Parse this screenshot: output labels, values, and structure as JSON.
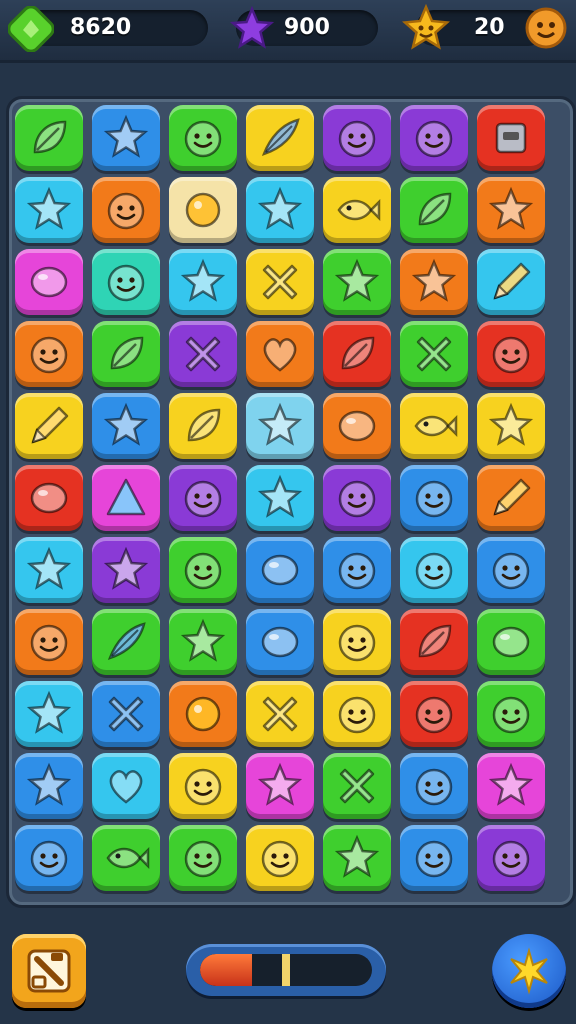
{
  "hud": {
    "score": "8620",
    "stars": "900",
    "level": "20"
  },
  "colors": {
    "green": "#3fcf2e",
    "blue": "#2f8fe8",
    "cyan": "#35c6ee",
    "yellow": "#f7d21f",
    "orange": "#f27a1a",
    "red": "#e53222",
    "purple": "#8a3ad6",
    "magenta": "#e645d9",
    "cream": "#f5e3a8",
    "teal": "#2fd4b5",
    "lightblue": "#7fd3ee"
  },
  "board": {
    "rows": [
      [
        {
          "bg": "green",
          "icon": "leaf-icon"
        },
        {
          "bg": "blue",
          "icon": "star-icon"
        },
        {
          "bg": "green",
          "icon": "smiley-face-icon"
        },
        {
          "bg": "yellow",
          "icon": "feather-icon"
        },
        {
          "bg": "purple",
          "icon": "smiley-face-icon"
        },
        {
          "bg": "purple",
          "icon": "smiley-face-icon"
        },
        {
          "bg": "red",
          "icon": "square-face-icon"
        }
      ],
      [
        {
          "bg": "cyan",
          "icon": "star-icon"
        },
        {
          "bg": "orange",
          "icon": "smiley-face-icon"
        },
        {
          "bg": "cream",
          "icon": "orb-icon"
        },
        {
          "bg": "cyan",
          "icon": "star-icon"
        },
        {
          "bg": "yellow",
          "icon": "fish-icon"
        },
        {
          "bg": "green",
          "icon": "leaf-icon"
        },
        {
          "bg": "orange",
          "icon": "star-icon"
        }
      ],
      [
        {
          "bg": "magenta",
          "icon": "bubble-icon"
        },
        {
          "bg": "teal",
          "icon": "smiley-face-icon"
        },
        {
          "bg": "cyan",
          "icon": "star-icon"
        },
        {
          "bg": "yellow",
          "icon": "cross-icon"
        },
        {
          "bg": "green",
          "icon": "star-icon"
        },
        {
          "bg": "orange",
          "icon": "star-icon"
        },
        {
          "bg": "cyan",
          "icon": "pencil-icon"
        }
      ],
      [
        {
          "bg": "orange",
          "icon": "smiley-face-icon"
        },
        {
          "bg": "green",
          "icon": "leaf-icon"
        },
        {
          "bg": "purple",
          "icon": "cross-icon"
        },
        {
          "bg": "orange",
          "icon": "heart-icon"
        },
        {
          "bg": "red",
          "icon": "leaf-icon"
        },
        {
          "bg": "green",
          "icon": "cross-icon"
        },
        {
          "bg": "red",
          "icon": "smiley-face-icon"
        }
      ],
      [
        {
          "bg": "yellow",
          "icon": "pencil-icon"
        },
        {
          "bg": "blue",
          "icon": "star-icon"
        },
        {
          "bg": "yellow",
          "icon": "leaf-icon"
        },
        {
          "bg": "lightblue",
          "icon": "star-icon"
        },
        {
          "bg": "orange",
          "icon": "bubble-icon"
        },
        {
          "bg": "yellow",
          "icon": "fish-icon"
        },
        {
          "bg": "yellow",
          "icon": "star-icon"
        }
      ],
      [
        {
          "bg": "red",
          "icon": "bubble-icon"
        },
        {
          "bg": "magenta",
          "icon": "triangle-icon"
        },
        {
          "bg": "purple",
          "icon": "smiley-face-icon"
        },
        {
          "bg": "cyan",
          "icon": "star-icon"
        },
        {
          "bg": "purple",
          "icon": "smiley-face-icon"
        },
        {
          "bg": "blue",
          "icon": "smiley-face-icon"
        },
        {
          "bg": "orange",
          "icon": "pencil-icon"
        }
      ],
      [
        {
          "bg": "cyan",
          "icon": "star-icon"
        },
        {
          "bg": "purple",
          "icon": "star-icon"
        },
        {
          "bg": "green",
          "icon": "smiley-face-icon"
        },
        {
          "bg": "blue",
          "icon": "bubble-icon"
        },
        {
          "bg": "blue",
          "icon": "smiley-face-icon"
        },
        {
          "bg": "cyan",
          "icon": "smiley-face-icon"
        },
        {
          "bg": "blue",
          "icon": "smiley-face-icon"
        }
      ],
      [
        {
          "bg": "orange",
          "icon": "smiley-face-icon"
        },
        {
          "bg": "green",
          "icon": "feather-icon"
        },
        {
          "bg": "green",
          "icon": "star-icon"
        },
        {
          "bg": "blue",
          "icon": "bubble-icon"
        },
        {
          "bg": "yellow",
          "icon": "smiley-face-icon"
        },
        {
          "bg": "red",
          "icon": "leaf-icon"
        },
        {
          "bg": "green",
          "icon": "bubble-icon"
        }
      ],
      [
        {
          "bg": "cyan",
          "icon": "star-icon"
        },
        {
          "bg": "blue",
          "icon": "cross-icon"
        },
        {
          "bg": "orange",
          "icon": "orb-icon"
        },
        {
          "bg": "yellow",
          "icon": "cross-icon"
        },
        {
          "bg": "yellow",
          "icon": "smiley-face-icon"
        },
        {
          "bg": "red",
          "icon": "smiley-face-icon"
        },
        {
          "bg": "green",
          "icon": "smiley-face-icon"
        }
      ],
      [
        {
          "bg": "blue",
          "icon": "star-icon"
        },
        {
          "bg": "cyan",
          "icon": "heart-icon"
        },
        {
          "bg": "yellow",
          "icon": "smiley-face-icon"
        },
        {
          "bg": "magenta",
          "icon": "star-icon"
        },
        {
          "bg": "green",
          "icon": "cross-icon"
        },
        {
          "bg": "blue",
          "icon": "smiley-face-icon"
        },
        {
          "bg": "magenta",
          "icon": "star-icon"
        }
      ],
      [
        {
          "bg": "blue",
          "icon": "smiley-face-icon"
        },
        {
          "bg": "green",
          "icon": "fish-icon"
        },
        {
          "bg": "green",
          "icon": "smiley-face-icon"
        },
        {
          "bg": "yellow",
          "icon": "smiley-face-icon"
        },
        {
          "bg": "green",
          "icon": "star-icon"
        },
        {
          "bg": "blue",
          "icon": "smiley-face-icon"
        },
        {
          "bg": "purple",
          "icon": "smiley-face-icon"
        }
      ]
    ]
  },
  "booster_meter": {
    "fill_fraction": 0.3,
    "marker_fraction": 0.5
  }
}
